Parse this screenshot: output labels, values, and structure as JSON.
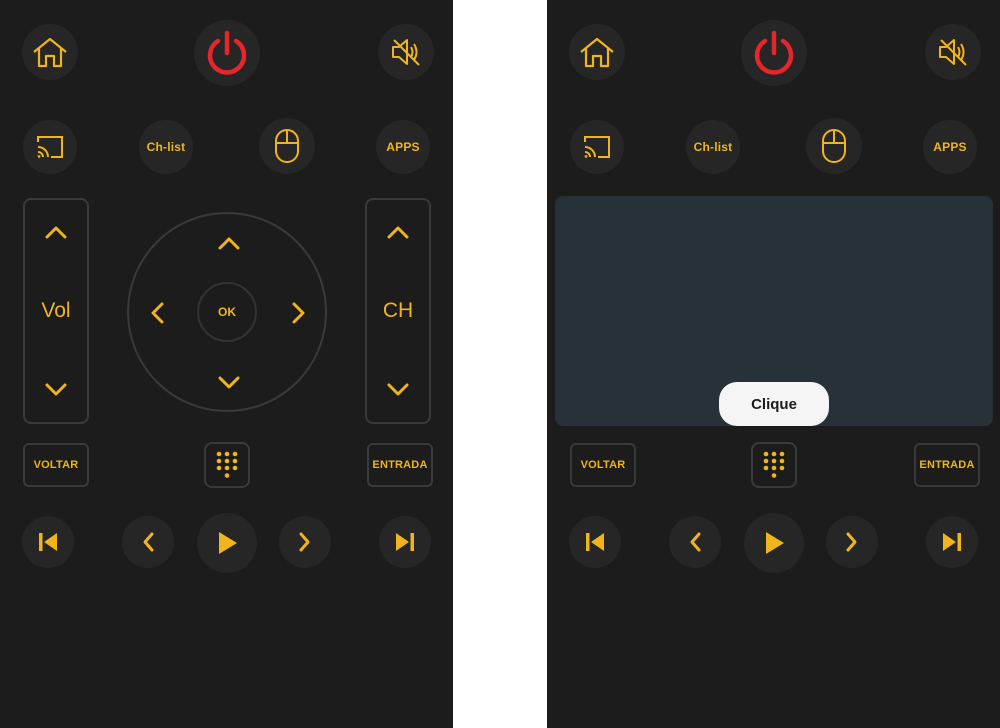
{
  "colors": {
    "accent": "#f0b41c",
    "power": "#e5262b",
    "background": "#1c1c1c",
    "touchpad": "#263238"
  },
  "icons": [
    "home-icon",
    "power-icon",
    "mute-icon",
    "cast-icon",
    "mouse-icon",
    "chevron-up-icon",
    "chevron-down-icon",
    "chevron-left-icon",
    "chevron-right-icon",
    "keypad-icon",
    "skip-previous-icon",
    "play-icon",
    "skip-next-icon"
  ],
  "left": {
    "chlist": "Ch-list",
    "apps": "APPS",
    "vol": "Vol",
    "ch": "CH",
    "ok": "OK",
    "voltar": "VOLTAR",
    "entrada": "ENTRADA"
  },
  "right": {
    "chlist": "Ch-list",
    "apps": "APPS",
    "clique": "Clique",
    "voltar": "VOLTAR",
    "entrada": "ENTRADA"
  }
}
